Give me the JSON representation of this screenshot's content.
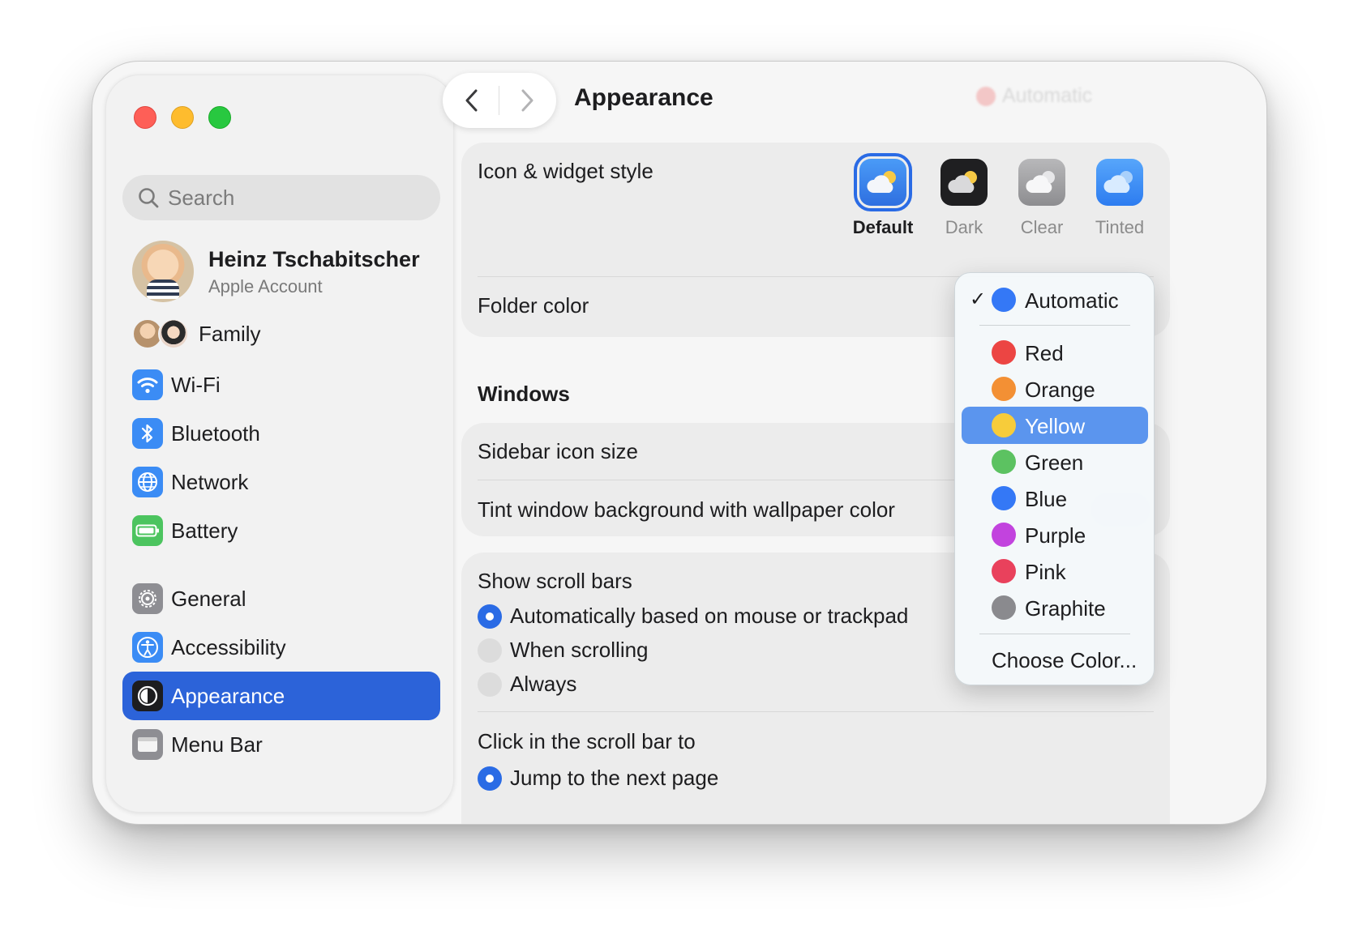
{
  "sidebar": {
    "search_placeholder": "Search",
    "profile": {
      "name": "Heinz Tschabitscher",
      "subtitle": "Apple Account"
    },
    "family_label": "Family",
    "items": [
      {
        "label": "Wi-Fi",
        "icon": "wifi-icon",
        "color": "#3b8cf5"
      },
      {
        "label": "Bluetooth",
        "icon": "bluetooth-icon",
        "color": "#3b8cf5"
      },
      {
        "label": "Network",
        "icon": "globe-icon",
        "color": "#3b8cf5"
      },
      {
        "label": "Battery",
        "icon": "battery-icon",
        "color": "#4cc45f"
      },
      {
        "label": "General",
        "icon": "gear-icon",
        "color": "#8e8e93"
      },
      {
        "label": "Accessibility",
        "icon": "accessibility-icon",
        "color": "#3b8cf5"
      },
      {
        "label": "Appearance",
        "icon": "appearance-icon",
        "color": "#1d1d1f",
        "selected": true
      },
      {
        "label": "Menu Bar",
        "icon": "menubar-icon",
        "color": "#8e8e93"
      }
    ]
  },
  "toolbar": {
    "title": "Appearance",
    "popup_value": "Automatic"
  },
  "content": {
    "icon_widget_style": {
      "label": "Icon & widget style",
      "options": [
        {
          "label": "Default",
          "selected": true
        },
        {
          "label": "Dark"
        },
        {
          "label": "Clear"
        },
        {
          "label": "Tinted"
        }
      ]
    },
    "folder_color_label": "Folder color",
    "windows_section": "Windows",
    "sidebar_icon_size_label": "Sidebar icon size",
    "tint_window_label": "Tint window background with wallpaper color",
    "show_scroll_bars": {
      "label": "Show scroll bars",
      "options": [
        {
          "label": "Automatically based on mouse or trackpad",
          "selected": true
        },
        {
          "label": "When scrolling"
        },
        {
          "label": "Always"
        }
      ]
    },
    "click_scroll_bar": {
      "label": "Click in the scroll bar to",
      "first_option": "Jump to the next page"
    }
  },
  "folder_color_menu": {
    "items": [
      {
        "label": "Automatic",
        "color": "#3478f6",
        "checked": true
      },
      {
        "label": "Red",
        "color": "#ec4543"
      },
      {
        "label": "Orange",
        "color": "#f39034"
      },
      {
        "label": "Yellow",
        "color": "#f7cc3a",
        "highlighted": true
      },
      {
        "label": "Green",
        "color": "#5cc261"
      },
      {
        "label": "Blue",
        "color": "#3478f6"
      },
      {
        "label": "Purple",
        "color": "#c243de"
      },
      {
        "label": "Pink",
        "color": "#e9415c"
      },
      {
        "label": "Graphite",
        "color": "#8a8a8e"
      }
    ],
    "choose_label": "Choose Color..."
  },
  "colors": {
    "accent": "#2c63d9",
    "highlight": "#5b95ee"
  }
}
